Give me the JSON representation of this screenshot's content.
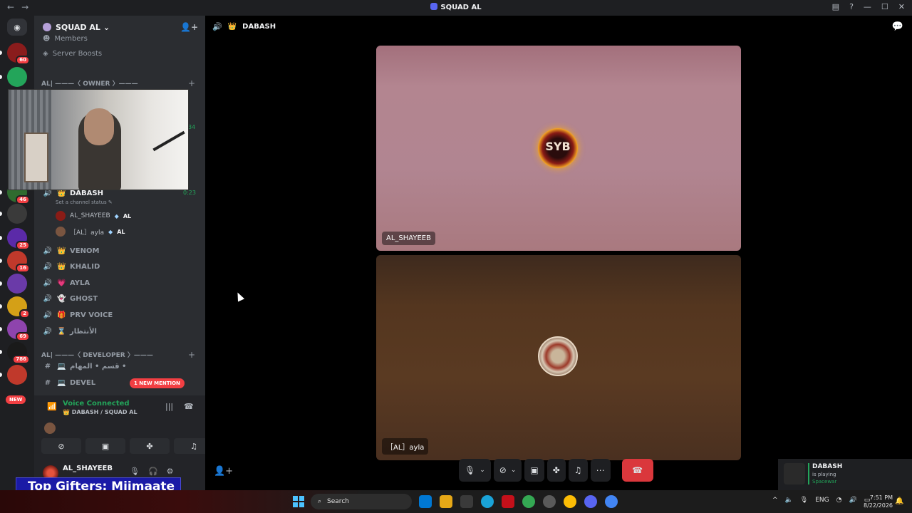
{
  "window": {
    "title": "SQUAD AL",
    "nav_back": "←",
    "nav_forward": "→",
    "inbox_icon": "inbox-icon",
    "help_icon": "help-icon",
    "minimize": "—",
    "maximize": "☐",
    "close": "✕"
  },
  "rail": {
    "home_icon": "discord-icon",
    "servers": [
      {
        "badge": "60",
        "color": "#8a1c1c"
      },
      {
        "badge": "",
        "color": "#23a55a"
      },
      {
        "badge": "46",
        "color": "#2f6b2f"
      },
      {
        "badge": "",
        "color": "#3a3a3a"
      },
      {
        "badge": "25",
        "color": "#5b2aa8"
      },
      {
        "badge": "16",
        "color": "#c0392b"
      },
      {
        "badge": "",
        "color": "#6a3aa8"
      },
      {
        "badge": "2",
        "color": "#d4a017"
      },
      {
        "badge": "69",
        "color": "#8e44ad"
      },
      {
        "badge": "786",
        "color": "#1a1a1a"
      },
      {
        "badge": "",
        "color": "#c0392b"
      }
    ],
    "new_label": "NEW"
  },
  "sidebar": {
    "server_name": "SQUAD AL",
    "server_chevron": "⌄",
    "members_label": "Members",
    "server_boosts_label": "Server Boosts",
    "owner_category": "AL| ———〈 OWNER 〉———",
    "overlay_timer_1": "34",
    "overlay_timer_2": "0:23",
    "current_channel": "DABASH",
    "set_status": "Set a channel status",
    "voice_users": [
      {
        "name": "AL_SHAYEEB",
        "tag": "AL"
      },
      {
        "name": "［AL］ayla",
        "tag": "AL"
      }
    ],
    "channels": [
      {
        "emoji": "👑",
        "name": "VENOM"
      },
      {
        "emoji": "👑",
        "name": "KHALID"
      },
      {
        "emoji": "💗",
        "name": "AYLA"
      },
      {
        "emoji": "👻",
        "name": "GHOST"
      },
      {
        "emoji": "🎁",
        "name": "PRV VOICE"
      },
      {
        "emoji": "⌛",
        "name": "الأنتظار"
      }
    ],
    "developer_category": "AL| ———〈 DEVELOPER 〉———",
    "text_channels": [
      {
        "name": "قسم • المهام •"
      },
      {
        "name": "DEVEL"
      }
    ],
    "mention_pill": "1 NEW MENTION"
  },
  "voice_panel": {
    "status": "Voice Connected",
    "location": "DABASH / SQUAD AL"
  },
  "user_panel": {
    "username": "AL_SHAYEEB"
  },
  "overlay": {
    "gifters": "Top Gifters: Miimaate"
  },
  "main": {
    "channel_title": "DABASH",
    "tiles": [
      {
        "name": "AL_SHAYEEB",
        "avatar_text": "SYB"
      },
      {
        "name": "［AL］ayla",
        "avatar_text": ""
      }
    ],
    "game_card": {
      "name": "DABASH",
      "activity": "is playing",
      "game": "Spacewar"
    }
  },
  "taskbar": {
    "search_placeholder": "Search",
    "language": "ENG",
    "time": "7:51 PM",
    "date": "8/22/2026"
  }
}
